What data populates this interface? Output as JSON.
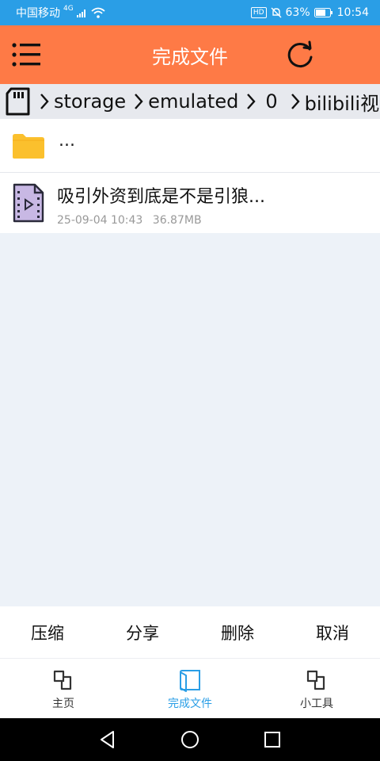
{
  "status_bar": {
    "carrier": "中国移动",
    "network": "4G",
    "hd": "HD",
    "battery": "63%",
    "time": "10:54"
  },
  "app_bar": {
    "title": "完成文件"
  },
  "breadcrumb": [
    "storage",
    "emulated",
    "0",
    "bilibili视"
  ],
  "files": {
    "parent_label": "...",
    "items": [
      {
        "name": "吸引外资到底是不是引狼...",
        "date": "25-09-04 10:43",
        "size": "36.87MB"
      }
    ]
  },
  "actions": [
    "压缩",
    "分享",
    "删除",
    "取消"
  ],
  "tabs": [
    {
      "label": "主页",
      "active": false
    },
    {
      "label": "完成文件",
      "active": true
    },
    {
      "label": "小工具",
      "active": false
    }
  ],
  "colors": {
    "status_bar": "#2a9ee6",
    "app_bar": "#fe7a46",
    "active_tab": "#2a9ee6",
    "folder": "#fbc02d",
    "video_icon": "#c8b8e4"
  },
  "icons": {
    "menu": "menu-icon",
    "refresh": "refresh-icon",
    "sd": "sd-card-icon",
    "folder": "folder-icon",
    "video": "video-file-icon"
  }
}
